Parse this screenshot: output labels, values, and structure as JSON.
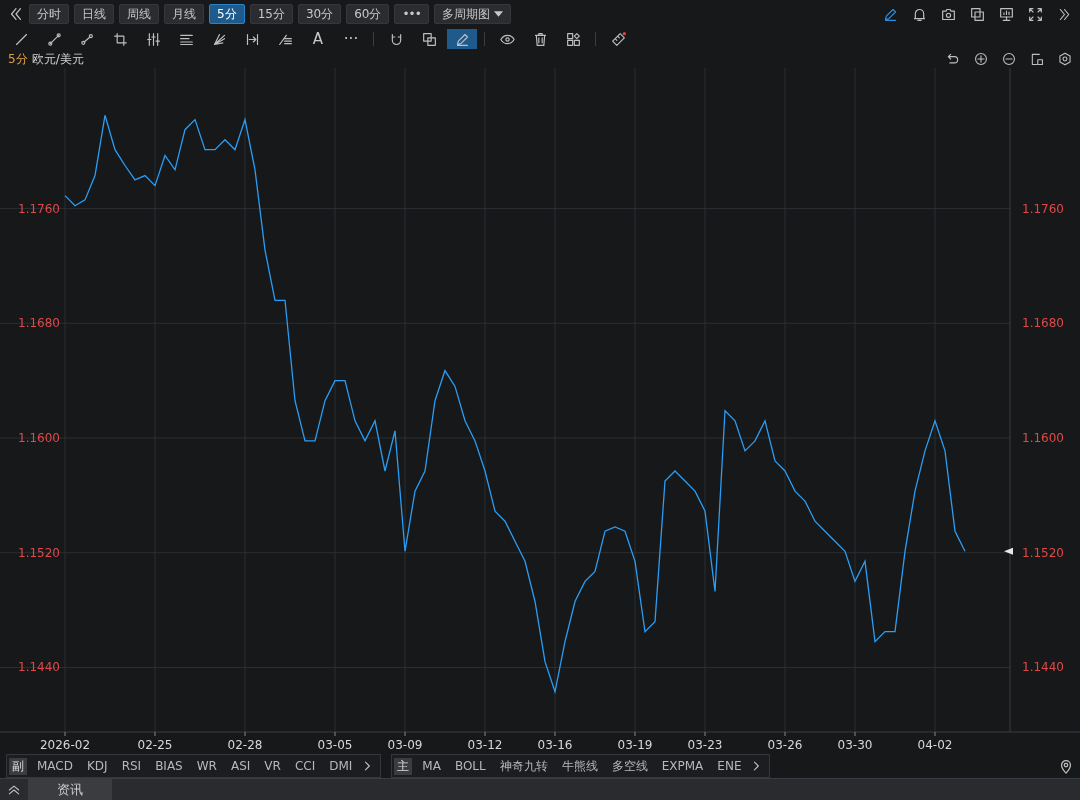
{
  "toolbar": {
    "periods": [
      {
        "label": "分时",
        "selected": false
      },
      {
        "label": "日线",
        "selected": false
      },
      {
        "label": "周线",
        "selected": false
      },
      {
        "label": "月线",
        "selected": false
      },
      {
        "label": "5分",
        "selected": true
      },
      {
        "label": "15分",
        "selected": false
      },
      {
        "label": "30分",
        "selected": false
      },
      {
        "label": "60分",
        "selected": false
      }
    ],
    "more": "•••",
    "multi_period": "多周期图"
  },
  "draw_tools": [
    {
      "kind": "line",
      "selected": false
    },
    {
      "kind": "segment",
      "selected": false
    },
    {
      "kind": "ray",
      "selected": false
    },
    {
      "kind": "crop",
      "selected": false
    },
    {
      "kind": "bars",
      "selected": false
    },
    {
      "kind": "channel",
      "selected": false
    },
    {
      "kind": "fan",
      "selected": false
    },
    {
      "kind": "measure",
      "selected": false
    },
    {
      "kind": "fib",
      "selected": false
    },
    {
      "kind": "text",
      "label": "A",
      "selected": false
    },
    {
      "kind": "text",
      "label": "···",
      "selected": false
    },
    {
      "kind": "divider"
    },
    {
      "kind": "magnet",
      "selected": false
    },
    {
      "kind": "layers",
      "selected": false
    },
    {
      "kind": "pencil",
      "selected": true
    },
    {
      "kind": "divider"
    },
    {
      "kind": "eye",
      "selected": false
    },
    {
      "kind": "trash",
      "selected": false
    },
    {
      "kind": "grid",
      "selected": false
    },
    {
      "kind": "divider"
    },
    {
      "kind": "ruler",
      "selected": false
    }
  ],
  "symbol": {
    "period": "5分"
  },
  "chart": {
    "chart_data": {
      "type": "line",
      "grid": true,
      "categories": [
        "2026-02",
        null,
        null,
        null,
        null,
        null,
        null,
        null,
        null,
        "02-25",
        null,
        null,
        null,
        null,
        null,
        null,
        null,
        null,
        "02-28",
        null,
        null,
        null,
        null,
        null,
        null,
        null,
        null,
        "03-05",
        null,
        null,
        null,
        null,
        null,
        null,
        "03-09",
        null,
        null,
        null,
        null,
        null,
        null,
        null,
        "03-12",
        null,
        null,
        null,
        null,
        null,
        null,
        "03-16",
        null,
        null,
        null,
        null,
        null,
        null,
        null,
        "03-19",
        null,
        null,
        null,
        null,
        null,
        null,
        "03-23",
        null,
        null,
        null,
        null,
        null,
        null,
        null,
        "03-26",
        null,
        null,
        null,
        null,
        null,
        null,
        "03-30",
        null,
        null,
        null,
        null,
        null,
        null,
        null,
        "04-02",
        null,
        null,
        null
      ],
      "ylim": [
        1.1395,
        1.1858
      ],
      "yticks": [
        {
          "value": 1.176,
          "label": "1.1760"
        },
        {
          "value": 1.168,
          "label": "1.1680"
        },
        {
          "value": 1.16,
          "label": "1.1600"
        },
        {
          "value": 1.152,
          "label": "1.1520"
        },
        {
          "value": 1.144,
          "label": "1.1440"
        }
      ],
      "series": [
        {
          "name": "欧元/美元",
          "color": "#2a9df4",
          "values": [
            1.1769,
            1.1762,
            1.1766,
            1.1783,
            1.1825,
            1.1801,
            1.179,
            1.178,
            1.1783,
            1.1776,
            1.1797,
            1.1787,
            1.1815,
            1.1822,
            1.1801,
            1.1801,
            1.1808,
            1.1801,
            1.1822,
            1.1787,
            1.1731,
            1.1696,
            1.1696,
            1.1626,
            1.1598,
            1.1598,
            1.1626,
            1.164,
            1.164,
            1.1612,
            1.1598,
            1.1612,
            1.1577,
            1.1605,
            1.1521,
            1.1563,
            1.1577,
            1.1626,
            1.1647,
            1.1636,
            1.1612,
            1.1598,
            1.1577,
            1.1549,
            1.1542,
            1.1528,
            1.1514,
            1.1486,
            1.1444,
            1.1423,
            1.1458,
            1.1486,
            1.15,
            1.1507,
            1.1535,
            1.1538,
            1.1535,
            1.1514,
            1.1465,
            1.1472,
            1.157,
            1.1577,
            1.157,
            1.1563,
            1.1549,
            1.1493,
            1.1619,
            1.1612,
            1.1591,
            1.1598,
            1.1612,
            1.1584,
            1.1577,
            1.1563,
            1.1556,
            1.1542,
            1.1535,
            1.1528,
            1.1521,
            1.15,
            1.1514,
            1.1458,
            1.1465,
            1.1465,
            1.1521,
            1.1563,
            1.1591,
            1.1612,
            1.1591,
            1.1535,
            1.1521
          ]
        }
      ]
    }
  },
  "sub_indicators": {
    "tag": "副",
    "items": [
      "MACD",
      "KDJ",
      "RSI",
      "BIAS",
      "WR",
      "ASI",
      "VR",
      "CCI",
      "DMI"
    ]
  },
  "main_indicators": {
    "tag": "主",
    "items": [
      "MA",
      "BOLL",
      "神奇九转",
      "牛熊线",
      "多空线",
      "EXPMA",
      "ENE"
    ]
  },
  "bottom_tabs": [
    {
      "label": "资讯",
      "selected": true
    }
  ]
}
